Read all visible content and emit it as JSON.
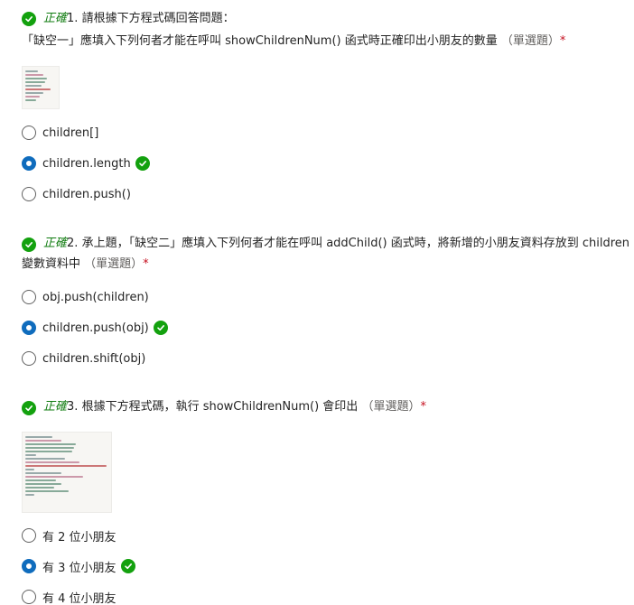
{
  "correct_label": "正確",
  "questions": [
    {
      "number": "1.",
      "title_prefix": "請根據下方程式碼回答問題：",
      "body": "「缺空一」應填入下列何者才能在呼叫 showChildrenNum() 函式時正確印出小朋友的數量",
      "type": "（單選題）",
      "required": "*",
      "options": [
        {
          "label": "children[]",
          "selected": false,
          "correct": false
        },
        {
          "label": "children.length",
          "selected": true,
          "correct": true
        },
        {
          "label": "children.push()",
          "selected": false,
          "correct": false
        }
      ]
    },
    {
      "number": "2.",
      "title_prefix": "承上題，「缺空二」應填入下列何者才能在呼叫 addChild() 函式時，將新增的小朋友資料存放到 children",
      "body": "變數資料中",
      "type": "（單選題）",
      "required": "*",
      "options": [
        {
          "label": "obj.push(children)",
          "selected": false,
          "correct": false
        },
        {
          "label": "children.push(obj)",
          "selected": true,
          "correct": true
        },
        {
          "label": "children.shift(obj)",
          "selected": false,
          "correct": false
        }
      ]
    },
    {
      "number": "3.",
      "title_prefix": "根據下方程式碼，執行 showChildrenNum() 會印出",
      "body": "",
      "type": "（單選題）",
      "required": "*",
      "options": [
        {
          "label": "有 2 位小朋友",
          "selected": false,
          "correct": false
        },
        {
          "label": "有 3 位小朋友",
          "selected": true,
          "correct": true
        },
        {
          "label": "有 4 位小朋友",
          "selected": false,
          "correct": false
        }
      ]
    }
  ],
  "colors": {
    "correct_green": "#13a10e",
    "radio_blue": "#0f6cbd",
    "required_red": "#c50f1f"
  },
  "icons": {
    "correct": "check-circle-icon"
  }
}
